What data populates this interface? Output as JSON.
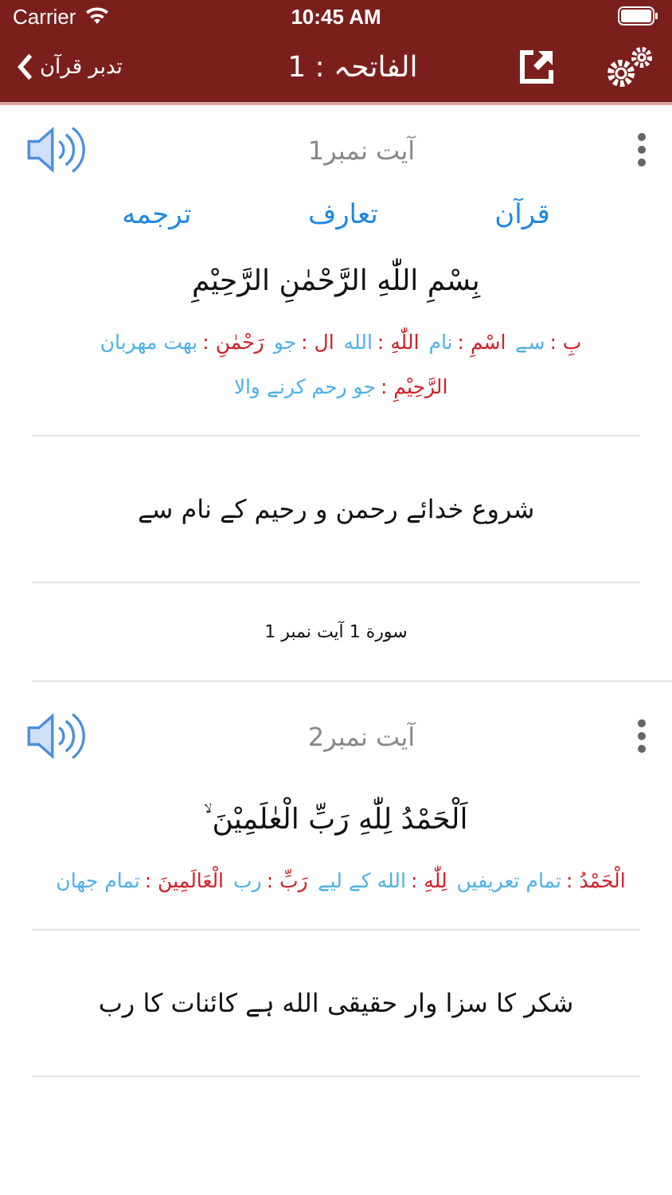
{
  "status_bar": {
    "carrier": "Carrier",
    "time": "10:45 AM"
  },
  "nav": {
    "back": "تدبر قرآن",
    "title": "الفاتحہ : 1"
  },
  "verses": [
    {
      "number": "آیت نمبر1",
      "tabs": [
        "قرآن",
        "تعارف",
        "ترجمه"
      ],
      "arabic": "بِسْمِ اللّٰهِ الرَّحْمٰنِ الرَّحِیْمِ",
      "words": [
        {
          "word": "بِ :",
          "meaning": "سے"
        },
        {
          "word": "اسْمِ :",
          "meaning": "نام"
        },
        {
          "word": "اللّٰهِ :",
          "meaning": "الله"
        },
        {
          "word": "ال :",
          "meaning": "جو"
        },
        {
          "word": "رَحْمٰنِ :",
          "meaning": "بهت مهربان"
        },
        {
          "word": "الرَّحِیْمِ :",
          "meaning": "جو رحم کرنے والا"
        }
      ],
      "translation": "شروع خدائے رحمن و رحیم کے نام سے",
      "footer": "سورة 1 آیت نمبر 1"
    },
    {
      "number": "آیت نمبر2",
      "arabic": "اَلْحَمْدُ لِلّٰهِ رَبِّ الْعٰلَمِیْنَ ۙ",
      "words": [
        {
          "word": "الْحَمْدُ :",
          "meaning": "تمام تعریفیں"
        },
        {
          "word": "لِلّٰهِ :",
          "meaning": "الله کے لیے"
        },
        {
          "word": "رَبِّ :",
          "meaning": "رب"
        },
        {
          "word": "الْعَالَمِينَ :",
          "meaning": "تمام جهان"
        }
      ],
      "translation": "شکر کا سزا وار حقیقی الله ہے کائنات کا رب"
    }
  ]
}
